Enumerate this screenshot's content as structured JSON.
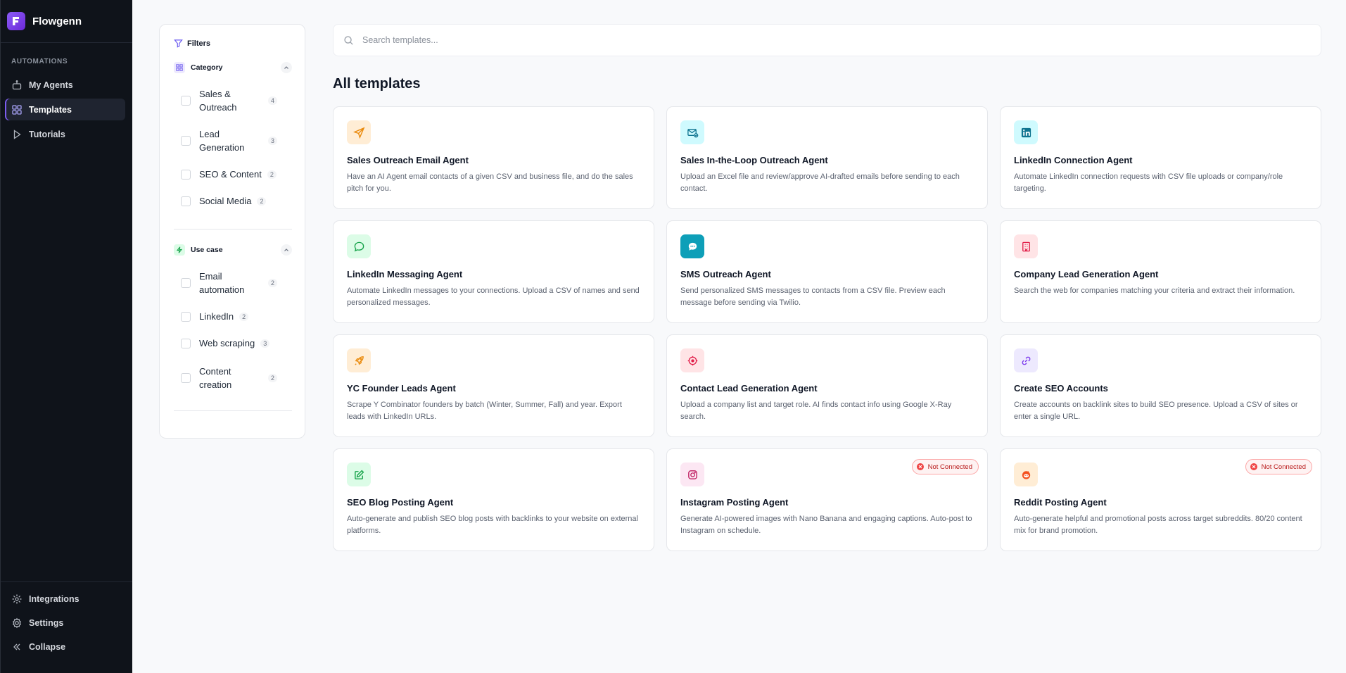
{
  "app": {
    "name": "Flowgenn"
  },
  "sidebar": {
    "section_label": "AUTOMATIONS",
    "items": [
      {
        "label": "My Agents",
        "icon": "robot-icon"
      },
      {
        "label": "Templates",
        "icon": "grid-icon",
        "active": true
      },
      {
        "label": "Tutorials",
        "icon": "play-icon"
      }
    ],
    "bottom": [
      {
        "label": "Integrations",
        "icon": "integrations-icon"
      },
      {
        "label": "Settings",
        "icon": "gear-icon"
      },
      {
        "label": "Collapse",
        "icon": "chevrons-left-icon"
      }
    ]
  },
  "filters": {
    "title": "Filters",
    "category": {
      "title": "Category",
      "options": [
        {
          "label": "Sales & Outreach",
          "count": "4"
        },
        {
          "label": "Lead Generation",
          "count": "3"
        },
        {
          "label": "SEO & Content",
          "count": "2"
        },
        {
          "label": "Social Media",
          "count": "2"
        }
      ]
    },
    "use_case": {
      "title": "Use case",
      "options": [
        {
          "label": "Email automation",
          "count": "2"
        },
        {
          "label": "LinkedIn",
          "count": "2"
        },
        {
          "label": "Web scraping",
          "count": "3"
        },
        {
          "label": "Content creation",
          "count": "2"
        }
      ]
    }
  },
  "search": {
    "placeholder": "Search templates..."
  },
  "main": {
    "title": "All templates",
    "badge_label": "Not Connected",
    "templates": [
      {
        "title": "Sales Outreach Email Agent",
        "desc": "Have an AI Agent email contacts of a given CSV and business file, and do the sales pitch for you.",
        "icon": "send-icon"
      },
      {
        "title": "Sales In-the-Loop Outreach Agent",
        "desc": "Upload an Excel file and review/approve AI-drafted emails before sending to each contact.",
        "icon": "mail-check-icon"
      },
      {
        "title": "LinkedIn Connection Agent",
        "desc": "Automate LinkedIn connection requests with CSV file uploads or company/role targeting.",
        "icon": "linkedin-icon"
      },
      {
        "title": "LinkedIn Messaging Agent",
        "desc": "Automate LinkedIn messages to your connections. Upload a CSV of names and send personalized messages.",
        "icon": "message-icon"
      },
      {
        "title": "SMS Outreach Agent",
        "desc": "Send personalized SMS messages to contacts from a CSV file. Preview each message before sending via Twilio.",
        "icon": "chat-bubble-icon"
      },
      {
        "title": "Company Lead Generation Agent",
        "desc": "Search the web for companies matching your criteria and extract their information.",
        "icon": "building-icon"
      },
      {
        "title": "YC Founder Leads Agent",
        "desc": "Scrape Y Combinator founders by batch (Winter, Summer, Fall) and year. Export leads with LinkedIn URLs.",
        "icon": "rocket-icon"
      },
      {
        "title": "Contact Lead Generation Agent",
        "desc": "Upload a company list and target role. AI finds contact info using Google X-Ray search.",
        "icon": "target-icon"
      },
      {
        "title": "Create SEO Accounts",
        "desc": "Create accounts on backlink sites to build SEO presence. Upload a CSV of sites or enter a single URL.",
        "icon": "link-icon"
      },
      {
        "title": "SEO Blog Posting Agent",
        "desc": "Auto-generate and publish SEO blog posts with backlinks to your website on external platforms.",
        "icon": "edit-icon"
      },
      {
        "title": "Instagram Posting Agent",
        "desc": "Generate AI-powered images with Nano Banana and engaging captions. Auto-post to Instagram on schedule.",
        "icon": "instagram-icon",
        "not_connected": true
      },
      {
        "title": "Reddit Posting Agent",
        "desc": "Auto-generate helpful and promotional posts across target subreddits. 80/20 content mix for brand promotion.",
        "icon": "reddit-icon",
        "not_connected": true
      }
    ]
  }
}
